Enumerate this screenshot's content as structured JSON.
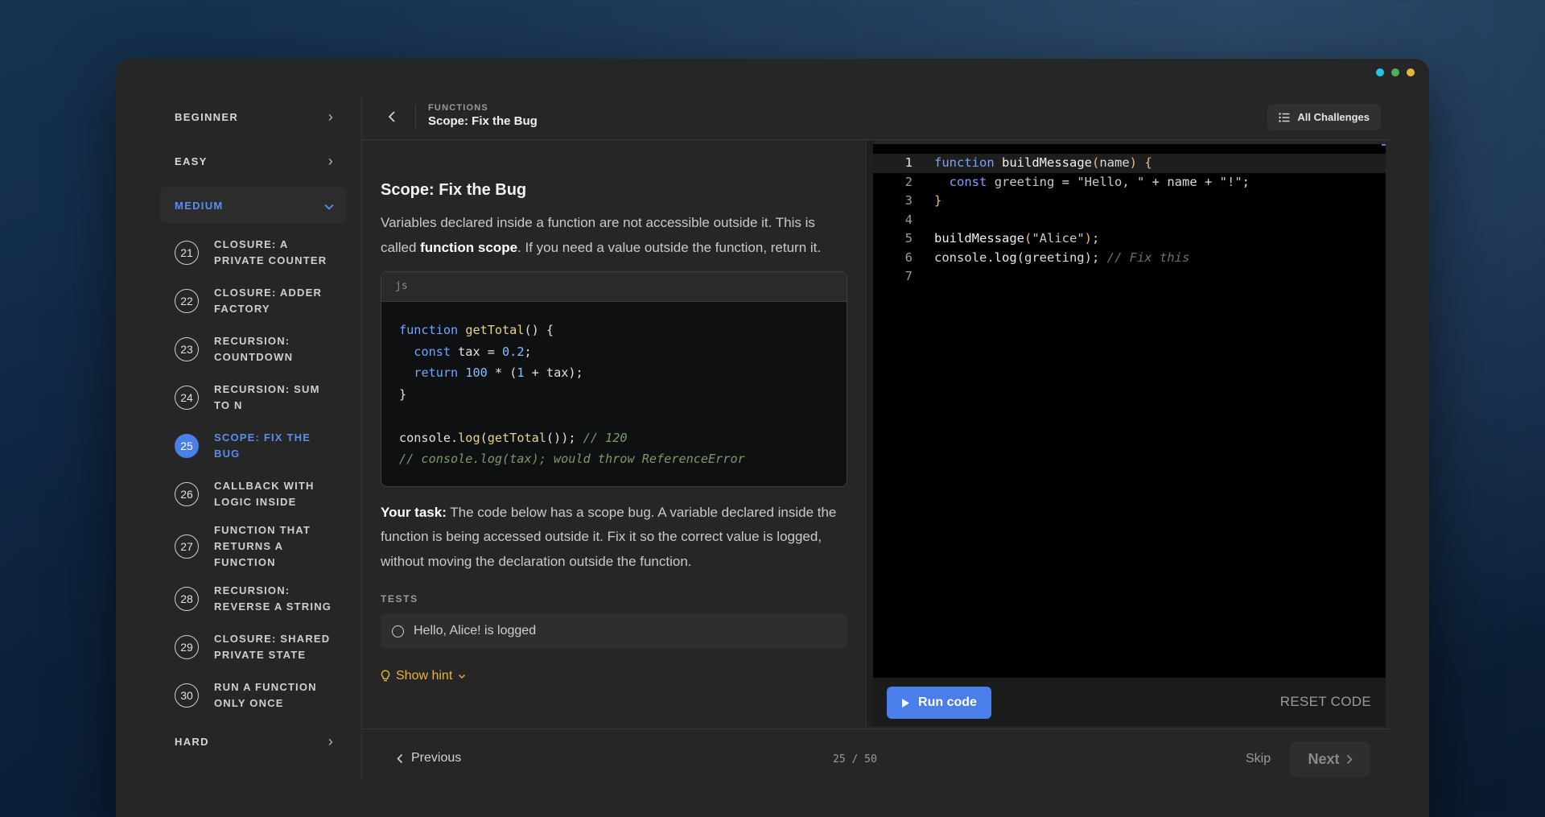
{
  "window": {
    "dots": [
      "#1fc8e3",
      "#4fb05a",
      "#e2b63b"
    ]
  },
  "sidebar": {
    "levels_top": [
      {
        "label": "BEGINNER"
      },
      {
        "label": "EASY"
      }
    ],
    "open_level": {
      "label": "MEDIUM"
    },
    "items": [
      {
        "num": "21",
        "label": "CLOSURE: A PRIVATE COUNTER"
      },
      {
        "num": "22",
        "label": "CLOSURE: ADDER FACTORY"
      },
      {
        "num": "23",
        "label": "RECURSION: COUNTDOWN"
      },
      {
        "num": "24",
        "label": "RECURSION: SUM TO N"
      },
      {
        "num": "25",
        "label": "SCOPE: FIX THE BUG",
        "active": true
      },
      {
        "num": "26",
        "label": "CALLBACK WITH LOGIC INSIDE"
      },
      {
        "num": "27",
        "label": "FUNCTION THAT RETURNS A FUNCTION"
      },
      {
        "num": "28",
        "label": "RECURSION: REVERSE A STRING"
      },
      {
        "num": "29",
        "label": "CLOSURE: SHARED PRIVATE STATE"
      },
      {
        "num": "30",
        "label": "RUN A FUNCTION ONLY ONCE"
      }
    ],
    "levels_bottom": [
      {
        "label": "HARD"
      }
    ]
  },
  "header": {
    "category": "FUNCTIONS",
    "title": "Scope: Fix the Bug",
    "all_challenges": "All Challenges"
  },
  "lesson": {
    "title": "Scope: Fix the Bug",
    "intro_1": "Variables declared inside a function are not accessible outside it. This is called ",
    "intro_bold": "function scope",
    "intro_2": ". If you need a value outside the function, return it.",
    "code_lang": "js",
    "task_label": "Your task:",
    "task_text": " The code below has a scope bug. A variable declared inside the function is being accessed outside it. Fix it so the correct value is logged, without moving the declaration outside the function.",
    "tests_heading": "TESTS",
    "tests": [
      "Hello, Alice! is logged"
    ],
    "hint_label": "Show hint"
  },
  "editor": {
    "line_numbers": [
      "1",
      "2",
      "3",
      "4",
      "5",
      "6",
      "7"
    ],
    "run_label": "Run code",
    "reset_label": "RESET CODE"
  },
  "footer": {
    "previous": "Previous",
    "counter": "25 / 50",
    "skip": "Skip",
    "next": "Next"
  }
}
